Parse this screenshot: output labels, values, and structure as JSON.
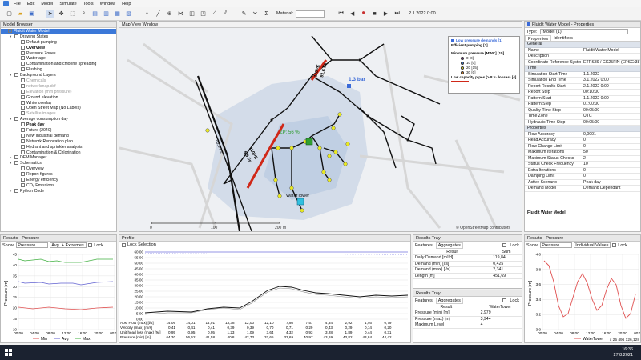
{
  "menu": [
    "File",
    "Edit",
    "Model",
    "Simulate",
    "Tools",
    "Window",
    "Help"
  ],
  "toolbar": {
    "material_label": "Material:",
    "sim_time": "2.1.2022 0:00"
  },
  "model_browser": {
    "title": "Model Browser",
    "items": [
      {
        "t": "Fluidit Water Model",
        "lv": 0,
        "cls": "sel"
      },
      {
        "t": "Drawing States",
        "lv": 1,
        "ar": "▾"
      },
      {
        "t": "Default pumping",
        "lv": 2
      },
      {
        "t": "Overview",
        "lv": 2,
        "cls": "b"
      },
      {
        "t": "Pressure Zones",
        "lv": 2
      },
      {
        "t": "Water age",
        "lv": 2
      },
      {
        "t": "Contamination and chlorine spreading",
        "lv": 2
      },
      {
        "t": "Flushing",
        "lv": 2
      },
      {
        "t": "Background Layers",
        "lv": 1,
        "ar": "▾"
      },
      {
        "t": "Chemicals",
        "lv": 2,
        "cls": "g"
      },
      {
        "t": "networkmap.dxf",
        "lv": 2,
        "cls": "g"
      },
      {
        "t": "Elevation (mm pressure)",
        "lv": 2,
        "cls": "g"
      },
      {
        "t": "Ground elevation",
        "lv": 2
      },
      {
        "t": "White overlay",
        "lv": 2
      },
      {
        "t": "Open Street Map (No Labels)",
        "lv": 2
      },
      {
        "t": "Satellite images",
        "lv": 2,
        "cls": "g"
      },
      {
        "t": "Average consumption day",
        "lv": 1,
        "ar": "▾"
      },
      {
        "t": "Peak day",
        "lv": 2,
        "cls": "b"
      },
      {
        "t": "Future (2040)",
        "lv": 2
      },
      {
        "t": "New industrial demand",
        "lv": 2
      },
      {
        "t": "Network Renovation plan",
        "lv": 2
      },
      {
        "t": "Hydrant and sprinkler analysis",
        "lv": 2
      },
      {
        "t": "Contamination & Chlorination",
        "lv": 2
      },
      {
        "t": "DEM Manager",
        "lv": 1,
        "ar": "▸"
      },
      {
        "t": "Schematics",
        "lv": 1,
        "ar": "▾"
      },
      {
        "t": "Overview",
        "lv": 2
      },
      {
        "t": "Report figures",
        "lv": 2
      },
      {
        "t": "Energy efficiency",
        "lv": 2
      },
      {
        "t": "CO₂ Emissions",
        "lv": 2
      },
      {
        "t": "Python Code",
        "lv": 1,
        "ar": "▸"
      }
    ]
  },
  "map": {
    "title": "Map View Window",
    "scale_0": "0",
    "scale_100": "100",
    "scale_200": "200",
    "scale_m": "m",
    "attribution": "© OpenStreetMap contributors",
    "pressure_label": "1.3 bar",
    "pump_label": "ZP: 56 %",
    "tower_label": "WaterTower",
    "pipe_labels": [
      "110PE",
      "91.6 l/s",
      "23.9 l/s",
      "110PE",
      "6.9 l/s"
    ]
  },
  "legend": {
    "title": "Low pressure demands [1]",
    "pump": "Efficient pumping [2]",
    "minp": "Minimum pressure [MWC] [15]",
    "items": [
      {
        "label": "0 [0]",
        "color": "#7a2a8a"
      },
      {
        "label": "10 [0]",
        "color": "#3a7ad8"
      },
      {
        "label": "20 [15]",
        "color": "#e8e820"
      },
      {
        "label": "30 [0]",
        "color": "#e08020"
      }
    ],
    "pipes": "Low capacity pipes (> 8 ‰ losses) [4]"
  },
  "properties": {
    "title": "Fluidit Water Model - Properties",
    "type_label": "Type:",
    "type_value": "Model (1)",
    "tabs": [
      "Properties",
      "Identifiers"
    ],
    "sections": [
      {
        "name": "General",
        "rows": [
          [
            "Name",
            "Fluidit Water Model"
          ],
          [
            "Description",
            ""
          ],
          [
            "Coordinate Reference System (",
            "ETRS89 / GK25FIN (EPSG:3879)"
          ]
        ]
      },
      {
        "name": "Time",
        "rows": [
          [
            "Simulation Start Time",
            "1.1.2022"
          ],
          [
            "Simulation End Time",
            "3.1.2022 0:00"
          ],
          [
            "Report Results Start",
            "2.1.2022 0:00"
          ],
          [
            "Report Step",
            "00:10:00"
          ],
          [
            "Pattern Start",
            "1.1.2022 0:00"
          ],
          [
            "Pattern Step",
            "01:00:00"
          ],
          [
            "Quality Time Step",
            "00:05:00"
          ],
          [
            "Time Zone",
            "UTC"
          ],
          [
            "Hydraulic Time Step",
            "00:05:00"
          ]
        ]
      },
      {
        "name": "Properties",
        "rows": [
          [
            "Flow Accuracy",
            "0,0001"
          ],
          [
            "Head Accuracy",
            "0"
          ],
          [
            "Flow Change Limit",
            "0"
          ],
          [
            "Maximum Iterations",
            "50"
          ],
          [
            "Maximum Status Checks",
            "2"
          ],
          [
            "Status Check Frequency",
            "10"
          ],
          [
            "Extra Iterations",
            "0"
          ],
          [
            "Damping Limit",
            "0"
          ],
          [
            "Active Scenario",
            "Peak day"
          ],
          [
            "Demand Model",
            "Demand Dependant"
          ]
        ]
      }
    ],
    "footer": "Fluidit Water Model"
  },
  "rp_left": {
    "title": "Results - Pressure",
    "show": "Show:",
    "sel1": "Pressure",
    "sel2": "Avg. + Extremes",
    "lock": "Lock",
    "ylabel": "Pressure [m]",
    "yticks": [
      "45",
      "40",
      "35",
      "30",
      "25",
      "20",
      "15",
      "10"
    ],
    "xticks": [
      "00:00",
      "04:00",
      "08:00",
      "12:00",
      "16:00",
      "20:00",
      "00:00"
    ],
    "legend": [
      "Min",
      "Avg",
      "Max"
    ]
  },
  "profile": {
    "title": "Profile",
    "lock": "Lock Selection",
    "yticks": [
      "60,00",
      "55,00",
      "50,00",
      "45,00",
      "40,00",
      "35,00",
      "30,00",
      "25,00",
      "20,00",
      "15,00",
      "10,00",
      "5,00",
      "0,00"
    ],
    "rowlabels": [
      "Abs. Flow (max) [l/s]",
      "Velocity (max) [m/s]",
      "Unit head loss (max) [‰]",
      "Pressure (min) [m]"
    ],
    "rows": [
      [
        "14,06",
        "14,01",
        "14,01",
        "13,38",
        "12,00",
        "12,10",
        "7,98",
        "7,57",
        "4,34",
        "2,92",
        "1,46",
        "0,79"
      ],
      [
        "0,41",
        "0,41",
        "0,41",
        "0,39",
        "0,39",
        "0,70",
        "0,71",
        "0,29",
        "0,43",
        "0,29",
        "0,14",
        "0,20"
      ],
      [
        "0,95",
        "0,95",
        "0,95",
        "1,23",
        "1,09",
        "3,64",
        "4,32",
        "0,93",
        "3,28",
        "1,89",
        "0,44",
        "0,31"
      ],
      [
        "64,30",
        "56,52",
        "41,58",
        "40,8",
        "42,73",
        "32,65",
        "33,69",
        "40,97",
        "43,69",
        "43,82",
        "43,84",
        "44,42"
      ]
    ]
  },
  "tray1": {
    "title": "Results Tray",
    "tabs": [
      "Features",
      "Aggregates"
    ],
    "lock": "Lock",
    "col1": "Result",
    "col2": "Sum",
    "rows": [
      [
        "Daily Demand [m³/d]",
        "119,84"
      ],
      [
        "Demand (min) [l/s]",
        "0,425"
      ],
      [
        "Demand (max) [l/s]",
        "2,341"
      ],
      [
        "Length [m]",
        "451,69"
      ]
    ]
  },
  "tray2": {
    "title": "Results Tray",
    "tabs": [
      "Features",
      "Aggregates"
    ],
    "lock": "Lock",
    "col1": "Result",
    "col2": "WaterTower",
    "rows": [
      [
        "Pressure (min) [m]",
        "2,979"
      ],
      [
        "Pressure (max) [m]",
        "3,944"
      ],
      [
        "Maximum Level",
        "4"
      ]
    ]
  },
  "rp_right": {
    "title": "Results - Pressure",
    "show": "Show:",
    "sel1": "Pressure",
    "sel2": "Individual Values",
    "lock": "Lock",
    "ylabel": "Pressure [m]",
    "yticks": [
      "4,0",
      "3,8",
      "3,6",
      "3,4",
      "3,2",
      "3,0"
    ],
    "xticks": [
      "00:00",
      "04:00",
      "08:00",
      "12:00",
      "16:00",
      "20:00",
      "00:00"
    ],
    "legend": "WaterTower"
  },
  "status": {
    "coords": "x 25 496 126,128",
    "coords2": "y 6 674 976,820"
  },
  "taskbar": {
    "time": "16:36",
    "date": "27.8.2021"
  }
}
